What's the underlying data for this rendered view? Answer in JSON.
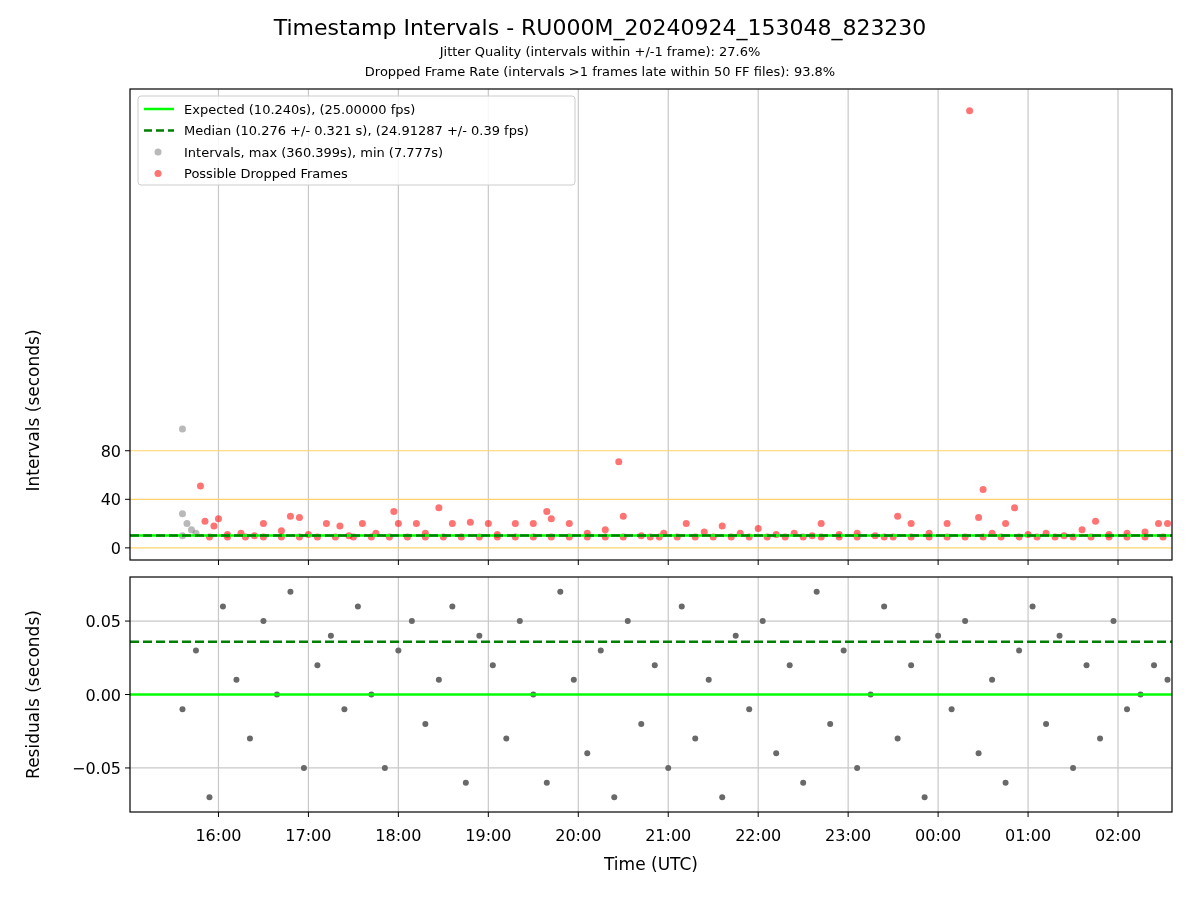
{
  "figure": {
    "title": "Timestamp Intervals - RU000M_20240924_153048_823230",
    "subtitles": [
      "Jitter Quality (intervals within +/-1 frame): 27.6%",
      "Dropped Frame Rate (intervals >1 frames late within 50 FF files): 93.8%"
    ]
  },
  "charts": [
    {
      "chart_data": {
        "type": "scatter",
        "ylabel": "Intervals (seconds)",
        "grid": true,
        "legend": "upper left",
        "xlim": [
          "2024-09-24T15:01",
          "2024-09-25T02:36"
        ],
        "ylim": [
          -10,
          378
        ],
        "yticks": [
          {
            "value": 0,
            "label": "0"
          },
          {
            "value": 40,
            "label": "40"
          },
          {
            "value": 80,
            "label": "80"
          }
        ],
        "series": [
          {
            "name": "Expected (10.240s), (25.00000 fps)",
            "type": "line",
            "line_style": "solid",
            "color": "#00ff00",
            "x": [
              "2024-09-24T15:01",
              "2024-09-25T02:36"
            ],
            "values": [
              10.24,
              10.24
            ]
          },
          {
            "name": "Median (10.276 +/- 0.321 s), (24.91287 +/- 0.39 fps)",
            "type": "line",
            "line_style": "dashed",
            "color": "#008000",
            "x": [
              "2024-09-24T15:01",
              "2024-09-25T02:36"
            ],
            "values": [
              10.276,
              10.276
            ]
          },
          {
            "name": "Intervals, max (360.399s), min (7.777s)",
            "type": "scatter",
            "color": "#808080",
            "x": [
              "2024-09-24T15:36",
              "2024-09-24T15:36",
              "2024-09-24T15:39",
              "2024-09-24T15:42",
              "2024-09-24T15:36",
              "2024-09-24T15:45"
            ],
            "values": [
              98,
              28,
              20,
              15,
              10,
              12
            ]
          },
          {
            "name": "Possible Dropped Frames",
            "type": "scatter",
            "color": "#ff0000",
            "x": [
              "2024-09-24T15:48",
              "2024-09-24T15:51",
              "2024-09-24T15:57",
              "2024-09-24T16:00",
              "2024-09-24T16:06",
              "2024-09-24T16:15",
              "2024-09-24T16:24",
              "2024-09-24T16:30",
              "2024-09-24T16:42",
              "2024-09-24T16:48",
              "2024-09-24T16:54",
              "2024-09-24T17:00",
              "2024-09-24T17:12",
              "2024-09-24T17:21",
              "2024-09-24T17:27",
              "2024-09-24T17:36",
              "2024-09-24T17:45",
              "2024-09-24T17:57",
              "2024-09-24T18:00",
              "2024-09-24T18:12",
              "2024-09-24T18:18",
              "2024-09-24T18:27",
              "2024-09-24T18:36",
              "2024-09-24T18:48",
              "2024-09-24T19:00",
              "2024-09-24T19:06",
              "2024-09-24T19:18",
              "2024-09-24T19:30",
              "2024-09-24T19:39",
              "2024-09-24T19:42",
              "2024-09-24T19:54",
              "2024-09-24T20:06",
              "2024-09-24T20:18",
              "2024-09-24T20:27",
              "2024-09-24T20:30",
              "2024-09-24T20:42",
              "2024-09-24T20:57",
              "2024-09-24T21:12",
              "2024-09-24T21:24",
              "2024-09-24T21:36",
              "2024-09-24T21:48",
              "2024-09-24T22:00",
              "2024-09-24T22:12",
              "2024-09-24T22:24",
              "2024-09-24T22:36",
              "2024-09-24T22:42",
              "2024-09-24T22:54",
              "2024-09-24T23:06",
              "2024-09-24T23:18",
              "2024-09-24T23:33",
              "2024-09-24T23:42",
              "2024-09-24T23:54",
              "2024-09-25T00:06",
              "2024-09-25T00:21",
              "2024-09-25T00:27",
              "2024-09-25T00:30",
              "2024-09-25T00:36",
              "2024-09-25T00:45",
              "2024-09-25T00:51",
              "2024-09-25T01:00",
              "2024-09-25T01:12",
              "2024-09-25T01:24",
              "2024-09-25T01:36",
              "2024-09-25T01:45",
              "2024-09-25T01:54",
              "2024-09-25T02:06",
              "2024-09-25T02:18",
              "2024-09-25T02:27",
              "2024-09-25T02:33",
              "2024-09-24T15:54",
              "2024-09-24T16:06",
              "2024-09-24T16:18",
              "2024-09-24T16:30",
              "2024-09-24T16:42",
              "2024-09-24T16:54",
              "2024-09-24T17:06",
              "2024-09-24T17:18",
              "2024-09-24T17:30",
              "2024-09-24T17:42",
              "2024-09-24T17:54",
              "2024-09-24T18:06",
              "2024-09-24T18:18",
              "2024-09-24T18:30",
              "2024-09-24T18:42",
              "2024-09-24T18:54",
              "2024-09-24T19:06",
              "2024-09-24T19:18",
              "2024-09-24T19:30",
              "2024-09-24T19:42",
              "2024-09-24T19:54",
              "2024-09-24T20:06",
              "2024-09-24T20:18",
              "2024-09-24T20:30",
              "2024-09-24T20:48",
              "2024-09-24T20:54",
              "2024-09-24T21:06",
              "2024-09-24T21:18",
              "2024-09-24T21:30",
              "2024-09-24T21:42",
              "2024-09-24T21:54",
              "2024-09-24T22:06",
              "2024-09-24T22:18",
              "2024-09-24T22:30",
              "2024-09-24T22:42",
              "2024-09-24T22:54",
              "2024-09-24T23:06",
              "2024-09-24T23:24",
              "2024-09-24T23:30",
              "2024-09-24T23:42",
              "2024-09-24T23:54",
              "2024-09-25T00:06",
              "2024-09-25T00:18",
              "2024-09-25T00:30",
              "2024-09-25T00:42",
              "2024-09-25T00:54",
              "2024-09-25T01:06",
              "2024-09-25T01:18",
              "2024-09-25T01:30",
              "2024-09-25T01:42",
              "2024-09-25T01:54",
              "2024-09-25T02:06",
              "2024-09-25T02:18",
              "2024-09-25T02:30"
            ],
            "values": [
              51,
              22,
              18,
              24,
              11,
              12,
              10,
              20,
              14,
              26,
              25,
              11,
              20,
              18,
              10,
              20,
              12,
              30,
              20,
              20,
              12,
              33,
              20,
              21,
              20,
              11,
              20,
              20,
              30,
              24,
              20,
              12,
              15,
              71,
              26,
              10,
              12,
              20,
              13,
              18,
              12,
              16,
              11,
              12,
              10,
              20,
              11,
              12,
              10,
              26,
              20,
              12,
              20,
              360,
              25,
              48,
              12,
              20,
              33,
              11,
              12,
              10,
              15,
              22,
              11,
              12,
              13,
              20,
              20,
              9,
              9,
              9,
              9,
              9,
              9,
              9,
              9,
              9,
              9,
              9,
              9,
              9,
              9,
              9,
              9,
              9,
              9,
              9,
              9,
              9,
              9,
              9,
              9,
              9,
              9,
              9,
              9,
              9,
              9,
              9,
              9,
              9,
              9,
              9,
              9,
              9,
              9,
              9,
              9,
              9,
              9,
              9,
              9,
              9,
              9,
              9,
              9,
              9,
              9,
              9,
              9,
              9,
              9
            ]
          }
        ]
      }
    },
    {
      "chart_data": {
        "type": "scatter",
        "ylabel": "Residuals (seconds)",
        "grid": true,
        "xlabel": "Time (UTC)",
        "xlim": [
          "2024-09-24T15:01",
          "2024-09-25T02:36"
        ],
        "ylim": [
          -0.08,
          0.08
        ],
        "xticks": [
          {
            "value": "2024-09-24T16:00",
            "label": "16:00"
          },
          {
            "value": "2024-09-24T17:00",
            "label": "17:00"
          },
          {
            "value": "2024-09-24T18:00",
            "label": "18:00"
          },
          {
            "value": "2024-09-24T19:00",
            "label": "19:00"
          },
          {
            "value": "2024-09-24T20:00",
            "label": "20:00"
          },
          {
            "value": "2024-09-24T21:00",
            "label": "21:00"
          },
          {
            "value": "2024-09-24T22:00",
            "label": "22:00"
          },
          {
            "value": "2024-09-24T23:00",
            "label": "23:00"
          },
          {
            "value": "2024-09-25T00:00",
            "label": "00:00"
          },
          {
            "value": "2024-09-25T01:00",
            "label": "01:00"
          },
          {
            "value": "2024-09-25T02:00",
            "label": "02:00"
          }
        ],
        "yticks": [
          {
            "value": -0.05,
            "label": "−0.05"
          },
          {
            "value": 0,
            "label": "0.00"
          },
          {
            "value": 0.05,
            "label": "0.05"
          }
        ],
        "series": [
          {
            "type": "line",
            "line_style": "solid",
            "color": "#00ff00",
            "x": [
              "2024-09-24T15:01",
              "2024-09-25T02:36"
            ],
            "values": [
              0,
              0
            ]
          },
          {
            "type": "line",
            "line_style": "dashed",
            "color": "#008000",
            "x": [
              "2024-09-24T15:01",
              "2024-09-25T02:36"
            ],
            "values": [
              0.036,
              0.036
            ]
          },
          {
            "type": "scatter",
            "color": "#696969",
            "x": [
              "2024-09-24T15:36",
              "2024-09-24T15:45",
              "2024-09-24T15:54",
              "2024-09-24T16:03",
              "2024-09-24T16:12",
              "2024-09-24T16:21",
              "2024-09-24T16:30",
              "2024-09-24T16:39",
              "2024-09-24T16:48",
              "2024-09-24T16:57",
              "2024-09-24T17:06",
              "2024-09-24T17:15",
              "2024-09-24T17:24",
              "2024-09-24T17:33",
              "2024-09-24T17:42",
              "2024-09-24T17:51",
              "2024-09-24T18:00",
              "2024-09-24T18:09",
              "2024-09-24T18:18",
              "2024-09-24T18:27",
              "2024-09-24T18:36",
              "2024-09-24T18:45",
              "2024-09-24T18:54",
              "2024-09-24T19:03",
              "2024-09-24T19:12",
              "2024-09-24T19:21",
              "2024-09-24T19:30",
              "2024-09-24T19:39",
              "2024-09-24T19:48",
              "2024-09-24T19:57",
              "2024-09-24T20:06",
              "2024-09-24T20:15",
              "2024-09-24T20:24",
              "2024-09-24T20:33",
              "2024-09-24T20:42",
              "2024-09-24T20:51",
              "2024-09-24T21:00",
              "2024-09-24T21:09",
              "2024-09-24T21:18",
              "2024-09-24T21:27",
              "2024-09-24T21:36",
              "2024-09-24T21:45",
              "2024-09-24T21:54",
              "2024-09-24T22:03",
              "2024-09-24T22:12",
              "2024-09-24T22:21",
              "2024-09-24T22:30",
              "2024-09-24T22:39",
              "2024-09-24T22:48",
              "2024-09-24T22:57",
              "2024-09-24T23:06",
              "2024-09-24T23:15",
              "2024-09-24T23:24",
              "2024-09-24T23:33",
              "2024-09-24T23:42",
              "2024-09-24T23:51",
              "2024-09-25T00:00",
              "2024-09-25T00:09",
              "2024-09-25T00:18",
              "2024-09-25T00:27",
              "2024-09-25T00:36",
              "2024-09-25T00:45",
              "2024-09-25T00:54",
              "2024-09-25T01:03",
              "2024-09-25T01:12",
              "2024-09-25T01:21",
              "2024-09-25T01:30",
              "2024-09-25T01:39",
              "2024-09-25T01:48",
              "2024-09-25T01:57",
              "2024-09-25T02:06",
              "2024-09-25T02:15",
              "2024-09-25T02:24",
              "2024-09-25T02:33"
            ],
            "values": [
              -0.01,
              0.03,
              -0.07,
              0.06,
              0.01,
              -0.03,
              0.05,
              0.0,
              0.07,
              -0.05,
              0.02,
              0.04,
              -0.01,
              0.06,
              0.0,
              -0.05,
              0.03,
              0.05,
              -0.02,
              0.01,
              0.06,
              -0.06,
              0.04,
              0.02,
              -0.03,
              0.05,
              0.0,
              -0.06,
              0.07,
              0.01,
              -0.04,
              0.03,
              -0.07,
              0.05,
              -0.02,
              0.02,
              -0.05,
              0.06,
              -0.03,
              0.01,
              -0.07,
              0.04,
              -0.01,
              0.05,
              -0.04,
              0.02,
              -0.06,
              0.07,
              -0.02,
              0.03,
              -0.05,
              0.0,
              0.06,
              -0.03,
              0.02,
              -0.07,
              0.04,
              -0.01,
              0.05,
              -0.04,
              0.01,
              -0.06,
              0.03,
              0.06,
              -0.02,
              0.04,
              -0.05,
              0.02,
              -0.03,
              0.05,
              -0.01,
              0.0,
              0.02,
              0.01
            ]
          }
        ]
      }
    }
  ]
}
